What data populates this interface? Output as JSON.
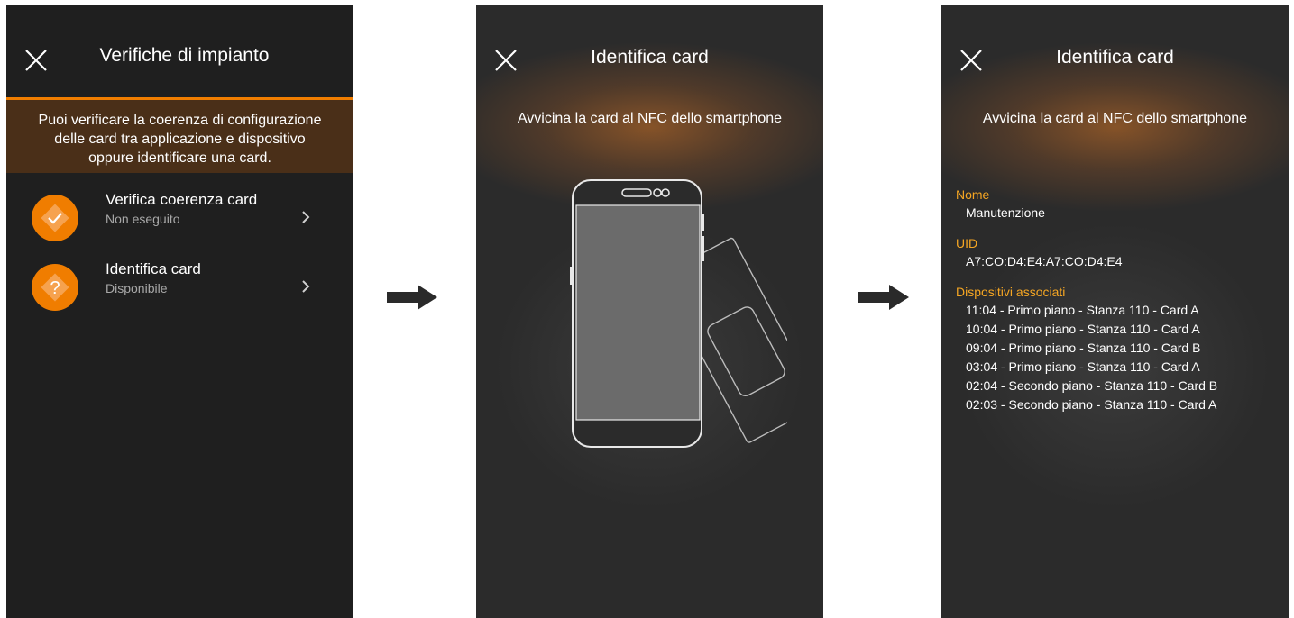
{
  "screens": {
    "home": {
      "title": "Verifiche di impianto",
      "close_icon": "close-icon",
      "banner_lines": [
        "Puoi verificare la coerenza di configurazione",
        "delle card tra applicazione e dispositivo",
        "oppure identificare una card."
      ],
      "items": [
        {
          "label": "Verifica coerenza card",
          "status": "Non eseguito",
          "icon": "checkmark-diamond-icon"
        },
        {
          "label": "Identifica card",
          "status": "Disponibile",
          "icon": "question-diamond-icon"
        }
      ]
    },
    "identify": {
      "title": "Identifica card",
      "subtitle": "Avvicina la card al NFC dello smartphone",
      "illustration": "phone-with-card-icon"
    },
    "result": {
      "title": "Identifica card",
      "subtitle": "Avvicina la card al NFC dello smartphone",
      "name_label": "Nome",
      "name_value": "Manutenzione",
      "uid_label": "UID",
      "uid_value": "A7:CO:D4:E4:A7:CO:D4:E4",
      "devices_label": "Dispositivi associati",
      "devices": [
        "11:04 - Primo piano - Stanza 110 - Card A",
        "10:04 - Primo piano - Stanza 110 - Card A",
        "09:04 - Primo piano - Stanza 110 - Card B",
        "03:04 - Primo piano - Stanza 110 - Card A",
        "02:04 - Secondo piano - Stanza 110 - Card B",
        "02:03 - Secondo piano - Stanza 110 - Card A"
      ]
    }
  },
  "arrows": [
    "right-arrow-icon",
    "right-arrow-icon"
  ],
  "colors": {
    "accent": "#f07d00",
    "label_yellow": "#f5a623",
    "banner_bg": "#4a2f18",
    "screen_bg_dark": "#1f1f1f",
    "screen_bg": "#2b2b2b"
  }
}
